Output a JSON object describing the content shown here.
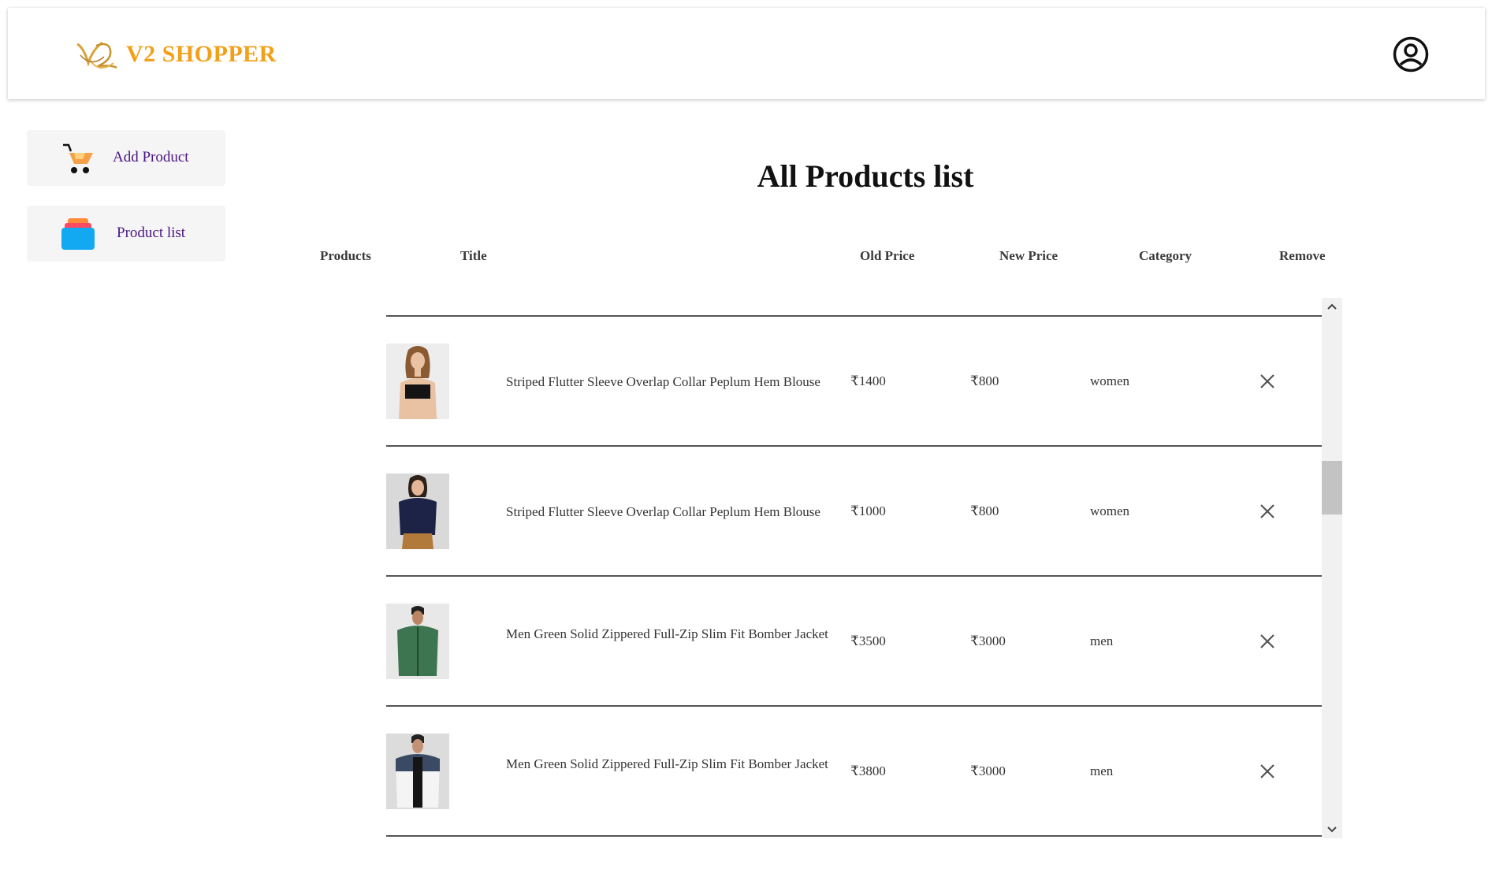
{
  "header": {
    "brand_name": "V2 SHOPPER",
    "logo_text": "V2",
    "brand_color": "#f3a019",
    "profile_icon": "user-circle-icon"
  },
  "sidebar": {
    "items": [
      {
        "label": "Add Product",
        "icon": "cart-icon"
      },
      {
        "label": "Product list",
        "icon": "stacked-list-icon"
      }
    ],
    "label_color": "#4b1585"
  },
  "main": {
    "title": "All Products list",
    "columns": [
      "Products",
      "Title",
      "Old Price",
      "New Price",
      "Category",
      "Remove"
    ],
    "products": [
      {
        "title": "Striped Flutter Sleeve Overlap Collar Peplum Hem Blouse",
        "old_price": "₹1400",
        "new_price": "₹800",
        "category": "women"
      },
      {
        "title": "Striped Flutter Sleeve Overlap Collar Peplum Hem Blouse",
        "old_price": "₹1000",
        "new_price": "₹800",
        "category": "women"
      },
      {
        "title": "Men Green Solid Zippered Full-Zip Slim Fit Bomber Jacket",
        "old_price": "₹3500",
        "new_price": "₹3000",
        "category": "men"
      },
      {
        "title": "Men Green Solid Zippered Full-Zip Slim Fit Bomber Jacket",
        "old_price": "₹3800",
        "new_price": "₹3000",
        "category": "men"
      }
    ]
  }
}
